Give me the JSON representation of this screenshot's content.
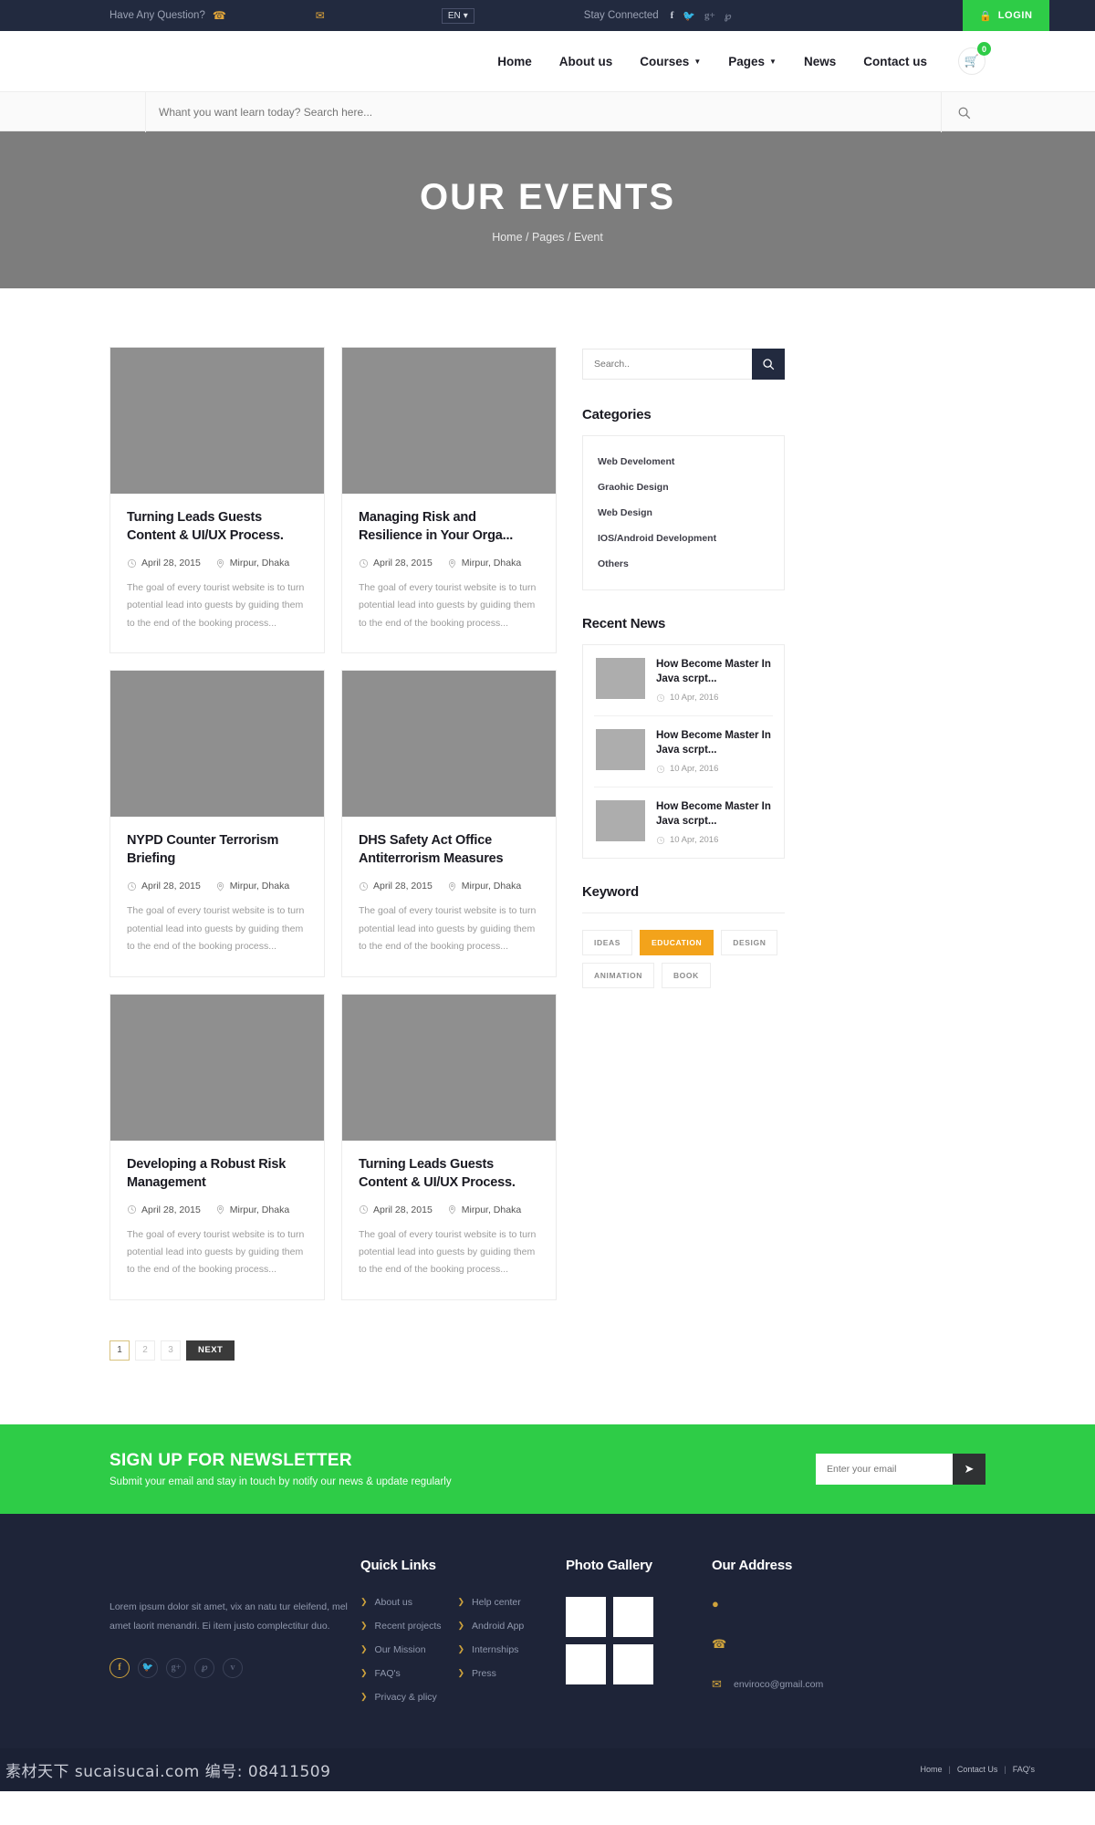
{
  "topbar": {
    "question_label": "Have Any Question?",
    "phone_icon": "phone-icon",
    "phone": "",
    "mail_icon": "mail-icon",
    "email": "",
    "language": "EN",
    "language_caret": "▾",
    "stay_connected_label": "Stay Connected",
    "socials": [
      "facebook-icon",
      "twitter-icon",
      "google-plus-icon",
      "pinterest-icon"
    ],
    "login_label": "LOGIN",
    "login_icon": "lock-icon",
    "login_bg": "#2ecc47"
  },
  "nav": {
    "items": [
      {
        "label": "Home",
        "has_caret": false
      },
      {
        "label": "About us",
        "has_caret": false
      },
      {
        "label": "Courses",
        "has_caret": true
      },
      {
        "label": "Pages",
        "has_caret": true
      },
      {
        "label": "News",
        "has_caret": false
      },
      {
        "label": "Contact us",
        "has_caret": false
      }
    ],
    "cart_icon": "cart-icon",
    "cart_count": "0"
  },
  "search_strip": {
    "placeholder": "Whant you want learn today? Search here...",
    "value": "",
    "button_icon": "search-icon"
  },
  "hero": {
    "title": "OUR EVENTS",
    "breadcrumb": "Home / Pages / Event"
  },
  "events": [
    {
      "title": "Turning Leads Guests Content & UI/UX Process.",
      "date": "April 28, 2015",
      "location": "Mirpur, Dhaka",
      "excerpt": "The goal of every tourist website is to turn potential lead into guests by guiding them to the end of the booking process..."
    },
    {
      "title": "Managing Risk and Resilience in Your Orga...",
      "date": "April 28, 2015",
      "location": "Mirpur, Dhaka",
      "excerpt": "The goal of every tourist website is to turn potential lead into guests by guiding them to the end of the booking process..."
    },
    {
      "title": "NYPD Counter Terrorism Briefing",
      "date": "April 28, 2015",
      "location": "Mirpur, Dhaka",
      "excerpt": "The goal of every tourist website is to turn potential lead into guests by guiding them to the end of the booking process..."
    },
    {
      "title": "DHS Safety Act Office Antiterrorism Measures",
      "date": "April 28, 2015",
      "location": "Mirpur, Dhaka",
      "excerpt": "The goal of every tourist website is to turn potential lead into guests by guiding them to the end of the booking process..."
    },
    {
      "title": "Developing a Robust Risk Management",
      "date": "April 28, 2015",
      "location": "Mirpur, Dhaka",
      "excerpt": "The goal of every tourist website is to turn potential lead into guests by guiding them to the end of the booking process..."
    },
    {
      "title": "Turning Leads Guests Content & UI/UX Process.",
      "date": "April 28, 2015",
      "location": "Mirpur, Dhaka",
      "excerpt": "The goal of every tourist website is to turn potential lead into guests by guiding them to the end of the booking process..."
    }
  ],
  "sidebar": {
    "search_placeholder": "Search..",
    "search_value": "",
    "search_icon": "search-icon",
    "categories_title": "Categories",
    "categories": [
      "Web Develoment",
      "Graohic Design",
      "Web Design",
      "IOS/Android Development",
      "Others"
    ],
    "recent_news_title": "Recent News",
    "recent_news": [
      {
        "title": "How Become Master In Java scrpt...",
        "date": "10 Apr, 2016"
      },
      {
        "title": "How Become Master In Java scrpt...",
        "date": "10 Apr, 2016"
      },
      {
        "title": "How Become Master In Java scrpt...",
        "date": "10 Apr, 2016"
      }
    ],
    "keyword_title": "Keyword",
    "keywords": [
      {
        "label": "IDEAS",
        "active": false
      },
      {
        "label": "EDUCATION",
        "active": true
      },
      {
        "label": "DESIGN",
        "active": false
      },
      {
        "label": "ANIMATION",
        "active": false
      },
      {
        "label": "BOOK",
        "active": false
      }
    ],
    "keyword_active_color": "#f3a31b"
  },
  "pagination": {
    "pages": [
      "1",
      "2",
      "3"
    ],
    "current": "1",
    "next_label": "NEXT"
  },
  "newsletter": {
    "title": "SIGN UP FOR NEWSLETTER",
    "subtitle": "Submit your email and stay in touch by notify our news & update regularly",
    "placeholder": "Enter your email",
    "value": "",
    "button_icon": "send-icon",
    "bg_color": "#2ecc47"
  },
  "footer": {
    "about_text": "Lorem ipsum dolor sit amet, vix an natu tur eleifend, mel amet laorit menandri. Ei item justo complectitur duo.",
    "socials": [
      "facebook-icon",
      "twitter-icon",
      "google-plus-icon",
      "pinterest-icon",
      "vimeo-icon"
    ],
    "quick_links_title": "Quick Links",
    "quick_links_col1": [
      "About us",
      "Recent projects",
      "Our Mission",
      "FAQ's",
      "Privacy & plicy"
    ],
    "quick_links_col2": [
      "Help center",
      "Android App",
      "Internships",
      "Press"
    ],
    "gallery_title": "Photo Gallery",
    "gallery_cells": 4,
    "address_title": "Our Address",
    "address_rows": [
      {
        "icon": "map-pin-icon",
        "text": ""
      },
      {
        "icon": "phone-icon",
        "text": ""
      },
      {
        "icon": "mail-icon",
        "text": "enviroco@gmail.com"
      }
    ]
  },
  "bottombar": {
    "watermark": "素材天下 sucaisucai.com 编号: 08411509",
    "links": [
      "Home",
      "Contact Us",
      "FAQ's"
    ],
    "separator": "|"
  }
}
